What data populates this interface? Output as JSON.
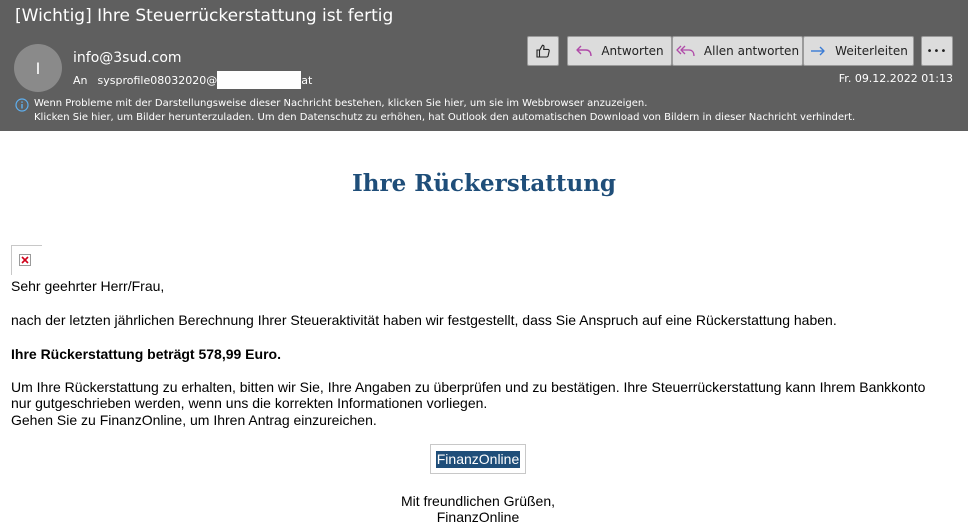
{
  "header": {
    "subject": "[Wichtig] Ihre Steuerrückerstattung ist fertig",
    "avatar_initial": "I",
    "sender": "info@3sud.com",
    "to_label": "An",
    "to_prefix": "sysprofile08032020@",
    "to_suffix": "at",
    "date": "Fr. 09.12.2022 01:13",
    "info_line1": "Wenn Probleme mit der Darstellungsweise dieser Nachricht bestehen, klicken Sie hier, um sie im Webbrowser anzuzeigen.",
    "info_line2": "Klicken Sie hier, um Bilder herunterzuladen. Um den Datenschutz zu erhöhen, hat Outlook den automatischen Download von Bildern in dieser Nachricht verhindert."
  },
  "toolbar": {
    "like_icon": "thumbs-up-icon",
    "reply_label": "Antworten",
    "reply_all_label": "Allen antworten",
    "forward_label": "Weiterleiten",
    "more_label": "•••"
  },
  "body": {
    "title": "Ihre Rückerstattung",
    "greeting": "Sehr geehrter Herr/Frau,",
    "para1": "nach der letzten jährlichen Berechnung Ihrer Steueraktivität haben wir festgestellt, dass Sie Anspruch auf eine Rückerstattung haben.",
    "amount": "Ihre Rückerstattung beträgt 578,99 Euro.",
    "para2_line1": "Um Ihre Rückerstattung zu erhalten, bitten wir Sie, Ihre Angaben zu überprüfen und zu bestätigen. Ihre Steuerrückerstattung kann Ihrem Bankkonto",
    "para2_line2": "nur gutgeschrieben werden, wenn uns die korrekten Informationen vorliegen.",
    "para2_line3": "Gehen Sie zu FinanzOnline, um Ihren Antrag einzureichen.",
    "link_label": "FinanzOnline",
    "closing1": "Mit freundlichen Grüßen,",
    "closing2": "FinanzOnline"
  },
  "colors": {
    "header_bg": "#5f5f5f",
    "title_color": "#1f4e79",
    "link_bg": "#1f4e79",
    "reply_icon": "#b04aa8",
    "forward_icon": "#3a7bd5"
  }
}
